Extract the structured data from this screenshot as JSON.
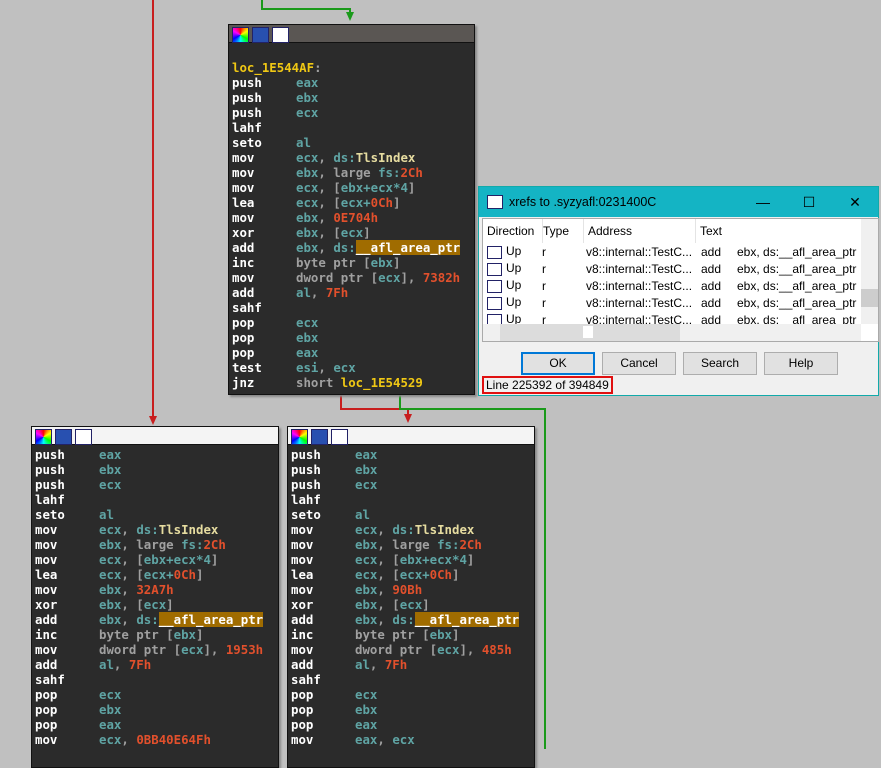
{
  "colors": {
    "edge_true": "#1a9a1a",
    "edge_false": "#c81e1e",
    "background": "#c0c0c0",
    "highlight": "#a06c00",
    "dialog_title": "#14b4c4"
  },
  "blocks": [
    {
      "name": "block-loc-1E544AF",
      "selected": true,
      "lines": [
        [
          [
            "",
            ""
          ]
        ],
        [
          [
            "loc_1E544AF",
            "l"
          ],
          [
            ":",
            "g"
          ]
        ],
        [
          [
            "push",
            "m"
          ],
          [
            "eax",
            "r"
          ]
        ],
        [
          [
            "push",
            "m"
          ],
          [
            "ebx",
            "r"
          ]
        ],
        [
          [
            "push",
            "m"
          ],
          [
            "ecx",
            "r"
          ]
        ],
        [
          [
            "lahf",
            "m"
          ]
        ],
        [
          [
            "seto",
            "m"
          ],
          [
            "al",
            "r"
          ]
        ],
        [
          [
            "mov",
            "m"
          ],
          [
            "ecx",
            "r"
          ],
          [
            ", ",
            "g"
          ],
          [
            "ds:",
            "r"
          ],
          [
            "TlsIndex",
            "t"
          ]
        ],
        [
          [
            "mov",
            "m"
          ],
          [
            "ebx",
            "r"
          ],
          [
            ", large ",
            "g"
          ],
          [
            "fs:",
            "r"
          ],
          [
            "2Ch",
            "n"
          ]
        ],
        [
          [
            "mov",
            "m"
          ],
          [
            "ecx",
            "r"
          ],
          [
            ", [",
            "g"
          ],
          [
            "ebx+ecx*4",
            "r"
          ],
          [
            "]",
            "g"
          ]
        ],
        [
          [
            "lea",
            "m"
          ],
          [
            "ecx",
            "r"
          ],
          [
            ", [",
            "g"
          ],
          [
            "ecx+",
            "r"
          ],
          [
            "0Ch",
            "n"
          ],
          [
            "]",
            "g"
          ]
        ],
        [
          [
            "mov",
            "m"
          ],
          [
            "ebx",
            "r"
          ],
          [
            ", ",
            "g"
          ],
          [
            "0E704h",
            "n"
          ]
        ],
        [
          [
            "xor",
            "m"
          ],
          [
            "ebx",
            "r"
          ],
          [
            ", [",
            "g"
          ],
          [
            "ecx",
            "r"
          ],
          [
            "]",
            "g"
          ]
        ],
        [
          [
            "add",
            "m"
          ],
          [
            "ebx",
            "r"
          ],
          [
            ", ",
            "g"
          ],
          [
            "ds:",
            "r"
          ],
          [
            "__afl_area_ptr",
            "h"
          ]
        ],
        [
          [
            "inc",
            "m"
          ],
          [
            "byte ptr [",
            "g"
          ],
          [
            "ebx",
            "r"
          ],
          [
            "]",
            "g"
          ]
        ],
        [
          [
            "mov",
            "m"
          ],
          [
            "dword ptr [",
            "g"
          ],
          [
            "ecx",
            "r"
          ],
          [
            "], ",
            "g"
          ],
          [
            "7382h",
            "n"
          ]
        ],
        [
          [
            "add",
            "m"
          ],
          [
            "al",
            "r"
          ],
          [
            ", ",
            "g"
          ],
          [
            "7Fh",
            "n"
          ]
        ],
        [
          [
            "sahf",
            "m"
          ]
        ],
        [
          [
            "pop",
            "m"
          ],
          [
            "ecx",
            "r"
          ]
        ],
        [
          [
            "pop",
            "m"
          ],
          [
            "ebx",
            "r"
          ]
        ],
        [
          [
            "pop",
            "m"
          ],
          [
            "eax",
            "r"
          ]
        ],
        [
          [
            "test",
            "m"
          ],
          [
            "esi",
            "r"
          ],
          [
            ", ",
            "g"
          ],
          [
            "ecx",
            "r"
          ]
        ],
        [
          [
            "jnz",
            "m"
          ],
          [
            "short ",
            "g"
          ],
          [
            "loc_1E54529",
            "l"
          ]
        ]
      ]
    },
    {
      "name": "block-left",
      "selected": false,
      "lines": [
        [
          [
            "push",
            "m"
          ],
          [
            "eax",
            "r"
          ]
        ],
        [
          [
            "push",
            "m"
          ],
          [
            "ebx",
            "r"
          ]
        ],
        [
          [
            "push",
            "m"
          ],
          [
            "ecx",
            "r"
          ]
        ],
        [
          [
            "lahf",
            "m"
          ]
        ],
        [
          [
            "seto",
            "m"
          ],
          [
            "al",
            "r"
          ]
        ],
        [
          [
            "mov",
            "m"
          ],
          [
            "ecx",
            "r"
          ],
          [
            ", ",
            "g"
          ],
          [
            "ds:",
            "r"
          ],
          [
            "TlsIndex",
            "t"
          ]
        ],
        [
          [
            "mov",
            "m"
          ],
          [
            "ebx",
            "r"
          ],
          [
            ", large ",
            "g"
          ],
          [
            "fs:",
            "r"
          ],
          [
            "2Ch",
            "n"
          ]
        ],
        [
          [
            "mov",
            "m"
          ],
          [
            "ecx",
            "r"
          ],
          [
            ", [",
            "g"
          ],
          [
            "ebx+ecx*4",
            "r"
          ],
          [
            "]",
            "g"
          ]
        ],
        [
          [
            "lea",
            "m"
          ],
          [
            "ecx",
            "r"
          ],
          [
            ", [",
            "g"
          ],
          [
            "ecx+",
            "r"
          ],
          [
            "0Ch",
            "n"
          ],
          [
            "]",
            "g"
          ]
        ],
        [
          [
            "mov",
            "m"
          ],
          [
            "ebx",
            "r"
          ],
          [
            ", ",
            "g"
          ],
          [
            "32A7h",
            "n"
          ]
        ],
        [
          [
            "xor",
            "m"
          ],
          [
            "ebx",
            "r"
          ],
          [
            ", [",
            "g"
          ],
          [
            "ecx",
            "r"
          ],
          [
            "]",
            "g"
          ]
        ],
        [
          [
            "add",
            "m"
          ],
          [
            "ebx",
            "r"
          ],
          [
            ", ",
            "g"
          ],
          [
            "ds:",
            "r"
          ],
          [
            "__afl_area_ptr",
            "h"
          ]
        ],
        [
          [
            "inc",
            "m"
          ],
          [
            "byte ptr [",
            "g"
          ],
          [
            "ebx",
            "r"
          ],
          [
            "]",
            "g"
          ]
        ],
        [
          [
            "mov",
            "m"
          ],
          [
            "dword ptr [",
            "g"
          ],
          [
            "ecx",
            "r"
          ],
          [
            "], ",
            "g"
          ],
          [
            "1953h",
            "n"
          ]
        ],
        [
          [
            "add",
            "m"
          ],
          [
            "al",
            "r"
          ],
          [
            ", ",
            "g"
          ],
          [
            "7Fh",
            "n"
          ]
        ],
        [
          [
            "sahf",
            "m"
          ]
        ],
        [
          [
            "pop",
            "m"
          ],
          [
            "ecx",
            "r"
          ]
        ],
        [
          [
            "pop",
            "m"
          ],
          [
            "ebx",
            "r"
          ]
        ],
        [
          [
            "pop",
            "m"
          ],
          [
            "eax",
            "r"
          ]
        ],
        [
          [
            "mov",
            "m"
          ],
          [
            "ecx",
            "r"
          ],
          [
            ", ",
            "g"
          ],
          [
            "0BB40E64Fh",
            "n"
          ]
        ]
      ]
    },
    {
      "name": "block-right",
      "selected": false,
      "lines": [
        [
          [
            "push",
            "m"
          ],
          [
            "eax",
            "r"
          ]
        ],
        [
          [
            "push",
            "m"
          ],
          [
            "ebx",
            "r"
          ]
        ],
        [
          [
            "push",
            "m"
          ],
          [
            "ecx",
            "r"
          ]
        ],
        [
          [
            "lahf",
            "m"
          ]
        ],
        [
          [
            "seto",
            "m"
          ],
          [
            "al",
            "r"
          ]
        ],
        [
          [
            "mov",
            "m"
          ],
          [
            "ecx",
            "r"
          ],
          [
            ", ",
            "g"
          ],
          [
            "ds:",
            "r"
          ],
          [
            "TlsIndex",
            "t"
          ]
        ],
        [
          [
            "mov",
            "m"
          ],
          [
            "ebx",
            "r"
          ],
          [
            ", large ",
            "g"
          ],
          [
            "fs:",
            "r"
          ],
          [
            "2Ch",
            "n"
          ]
        ],
        [
          [
            "mov",
            "m"
          ],
          [
            "ecx",
            "r"
          ],
          [
            ", [",
            "g"
          ],
          [
            "ebx+ecx*4",
            "r"
          ],
          [
            "]",
            "g"
          ]
        ],
        [
          [
            "lea",
            "m"
          ],
          [
            "ecx",
            "r"
          ],
          [
            ", [",
            "g"
          ],
          [
            "ecx+",
            "r"
          ],
          [
            "0Ch",
            "n"
          ],
          [
            "]",
            "g"
          ]
        ],
        [
          [
            "mov",
            "m"
          ],
          [
            "ebx",
            "r"
          ],
          [
            ", ",
            "g"
          ],
          [
            "90Bh",
            "n"
          ]
        ],
        [
          [
            "xor",
            "m"
          ],
          [
            "ebx",
            "r"
          ],
          [
            ", [",
            "g"
          ],
          [
            "ecx",
            "r"
          ],
          [
            "]",
            "g"
          ]
        ],
        [
          [
            "add",
            "m"
          ],
          [
            "ebx",
            "r"
          ],
          [
            ", ",
            "g"
          ],
          [
            "ds:",
            "r"
          ],
          [
            "__afl_area_ptr",
            "h"
          ]
        ],
        [
          [
            "inc",
            "m"
          ],
          [
            "byte ptr [",
            "g"
          ],
          [
            "ebx",
            "r"
          ],
          [
            "]",
            "g"
          ]
        ],
        [
          [
            "mov",
            "m"
          ],
          [
            "dword ptr [",
            "g"
          ],
          [
            "ecx",
            "r"
          ],
          [
            "], ",
            "g"
          ],
          [
            "485h",
            "n"
          ]
        ],
        [
          [
            "add",
            "m"
          ],
          [
            "al",
            "r"
          ],
          [
            ", ",
            "g"
          ],
          [
            "7Fh",
            "n"
          ]
        ],
        [
          [
            "sahf",
            "m"
          ]
        ],
        [
          [
            "pop",
            "m"
          ],
          [
            "ecx",
            "r"
          ]
        ],
        [
          [
            "pop",
            "m"
          ],
          [
            "ebx",
            "r"
          ]
        ],
        [
          [
            "pop",
            "m"
          ],
          [
            "eax",
            "r"
          ]
        ],
        [
          [
            "mov",
            "m"
          ],
          [
            "eax",
            "r"
          ],
          [
            ", ",
            "g"
          ],
          [
            "ecx",
            "r"
          ]
        ]
      ]
    }
  ],
  "dialog": {
    "title": "xrefs to .syzyafl:0231400C",
    "window_buttons": {
      "minimize": "—",
      "maximize": "☐",
      "close": "✕"
    },
    "columns": [
      "Direction",
      "Type",
      "Address",
      "Text"
    ],
    "rows": [
      {
        "direction": "Up",
        "type": "r",
        "address": "v8::internal::TestC...",
        "mnemonic": "add",
        "operands": "ebx, ds:__afl_area_ptr"
      },
      {
        "direction": "Up",
        "type": "r",
        "address": "v8::internal::TestC...",
        "mnemonic": "add",
        "operands": "ebx, ds:__afl_area_ptr"
      },
      {
        "direction": "Up",
        "type": "r",
        "address": "v8::internal::TestC...",
        "mnemonic": "add",
        "operands": "ebx, ds:__afl_area_ptr"
      },
      {
        "direction": "Up",
        "type": "r",
        "address": "v8::internal::TestC...",
        "mnemonic": "add",
        "operands": "ebx, ds:__afl_area_ptr"
      },
      {
        "direction": "Up",
        "type": "r",
        "address": "v8::internal::TestC...",
        "mnemonic": "add",
        "operands": "ebx, ds:__afl_area_ptr"
      }
    ],
    "buttons": {
      "ok": "OK",
      "cancel": "Cancel",
      "search": "Search",
      "help": "Help"
    },
    "status": "Line 225392 of 394849"
  }
}
